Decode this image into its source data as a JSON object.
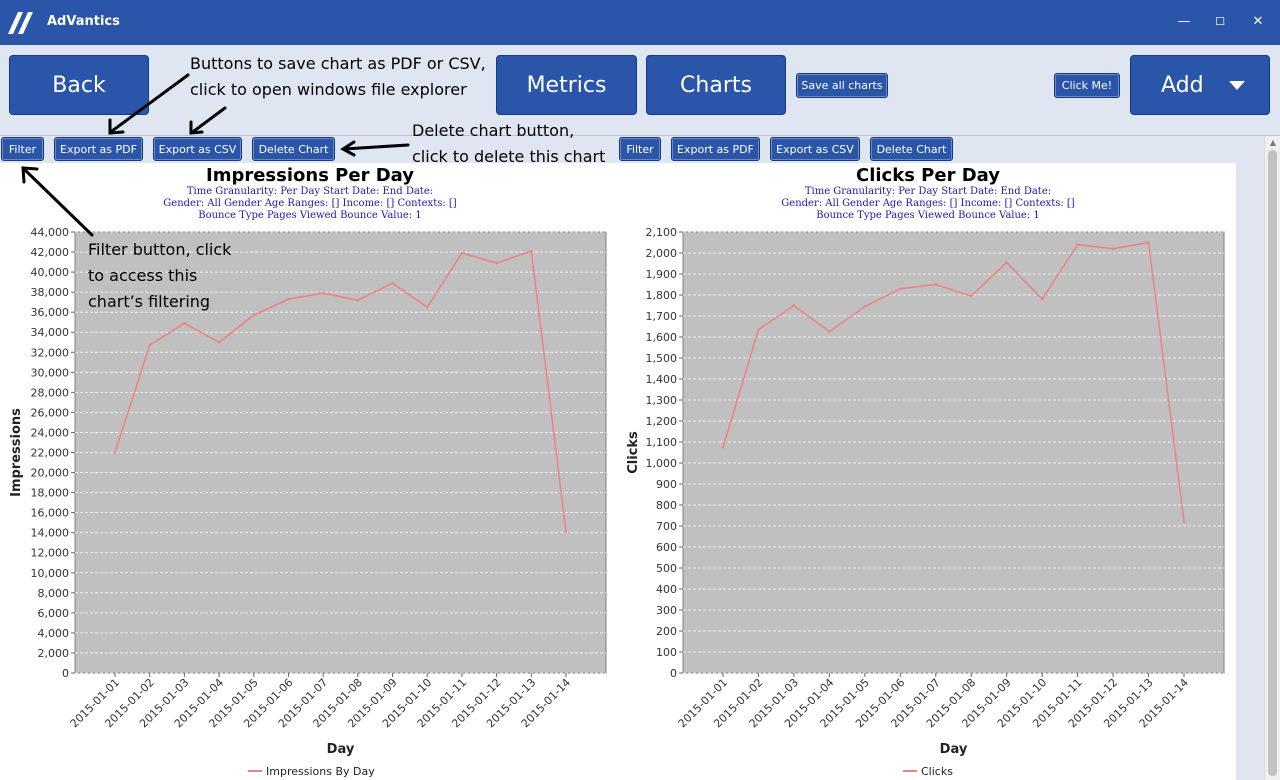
{
  "app": {
    "title": "AdVantics"
  },
  "window_controls": {
    "minimize": "—",
    "maximize": "☐",
    "close": "✕"
  },
  "toolbar": {
    "back": "Back",
    "metrics": "Metrics",
    "charts": "Charts",
    "save_all": "Save all charts",
    "click_me": "Click Me!",
    "add": "Add"
  },
  "annotations": {
    "export_line1": "Buttons to save chart as PDF or CSV,",
    "export_line2": "click to open windows file explorer",
    "delete_line1": "Delete chart button,",
    "delete_line2": "click to delete this chart",
    "filter_line1": "Filter button, click",
    "filter_line2": "to access this",
    "filter_line3": "chart’s filtering"
  },
  "charts": [
    {
      "buttons": {
        "filter": "Filter",
        "export_pdf": "Export as PDF",
        "export_csv": "Export as CSV",
        "delete": "Delete Chart"
      },
      "title": "Impressions Per Day",
      "sub1": "Time Granularity: Per Day   Start Date:     End Date:",
      "sub2": "Gender: All Gender   Age Ranges: []   Income: []   Contexts: []",
      "sub3": "Bounce Type Pages Viewed   Bounce Value: 1",
      "ylabel": "Impressions",
      "xlabel": "Day",
      "legend": "Impressions By Day"
    },
    {
      "buttons": {
        "filter": "Filter",
        "export_pdf": "Export as PDF",
        "export_csv": "Export as CSV",
        "delete": "Delete Chart"
      },
      "title": "Clicks Per Day",
      "sub1": "Time Granularity: Per Day   Start Date:     End Date:",
      "sub2": "Gender: All Gender   Age Ranges: []   Income: []   Contexts: []",
      "sub3": "Bounce Type Pages Viewed   Bounce Value: 1",
      "ylabel": "Clicks",
      "xlabel": "Day",
      "legend": "Clicks"
    }
  ],
  "chart_data": [
    {
      "type": "line",
      "title": "Impressions Per Day",
      "xlabel": "Day",
      "ylabel": "Impressions",
      "categories": [
        "2015-01-01",
        "2015-01-02",
        "2015-01-03",
        "2015-01-04",
        "2015-01-05",
        "2015-01-06",
        "2015-01-07",
        "2015-01-08",
        "2015-01-09",
        "2015-01-10",
        "2015-01-11",
        "2015-01-12",
        "2015-01-13",
        "2015-01-14"
      ],
      "series": [
        {
          "name": "Impressions By Day",
          "color": "#f08080",
          "values": [
            22000,
            32700,
            34900,
            33000,
            35700,
            37300,
            37900,
            37200,
            38900,
            36500,
            41900,
            40900,
            42100,
            14100
          ]
        }
      ],
      "ylim": [
        0,
        44000
      ],
      "ytick_step": 2000,
      "grid": true,
      "legend_position": "bottom"
    },
    {
      "type": "line",
      "title": "Clicks Per Day",
      "xlabel": "Day",
      "ylabel": "Clicks",
      "categories": [
        "2015-01-01",
        "2015-01-02",
        "2015-01-03",
        "2015-01-04",
        "2015-01-05",
        "2015-01-06",
        "2015-01-07",
        "2015-01-08",
        "2015-01-09",
        "2015-01-10",
        "2015-01-11",
        "2015-01-12",
        "2015-01-13",
        "2015-01-14"
      ],
      "series": [
        {
          "name": "Clicks",
          "color": "#f08080",
          "values": [
            1075,
            1635,
            1750,
            1625,
            1745,
            1830,
            1850,
            1795,
            1955,
            1780,
            2040,
            2020,
            2050,
            720
          ]
        }
      ],
      "ylim": [
        0,
        2100
      ],
      "ytick_step": 100,
      "grid": true,
      "legend_position": "bottom"
    }
  ]
}
